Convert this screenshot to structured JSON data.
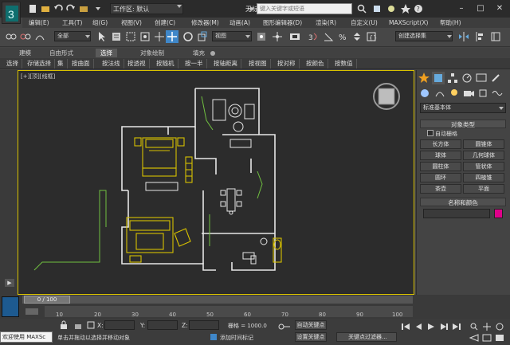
{
  "title_bar": {
    "workspace_label": "工作区: 默认",
    "document_title": "无标题",
    "search_placeholder": "键入关键字或短语"
  },
  "menu": {
    "items": [
      "编辑(E)",
      "工具(T)",
      "组(G)",
      "视图(V)",
      "创建(C)",
      "修改器(M)",
      "动画(A)",
      "图形编辑器(D)",
      "渲染(R)",
      "自定义(U)",
      "MAXScript(X)",
      "帮助(H)"
    ]
  },
  "toolbar": {
    "filter_value": "全部",
    "refcoord_value": "视图",
    "named_selection_placeholder": "创建选择集"
  },
  "ribbon": {
    "tabs": [
      "建模",
      "自由形式",
      "选择",
      "对象绘制",
      "填充"
    ],
    "active_tab": "选择"
  },
  "selection_bar": {
    "items": [
      "选择",
      "存储选择",
      "集",
      "按曲面",
      "按法线",
      "按透视",
      "按随机",
      "按一半",
      "按轴距离",
      "按视图",
      "按对称",
      "按颜色",
      "按数值"
    ]
  },
  "viewport": {
    "label": "[+][顶][线框]"
  },
  "command_panel": {
    "category": "标准基本体",
    "object_type_title": "对象类型",
    "autogrid_label": "自动栅格",
    "object_buttons": [
      "长方体",
      "圆锥体",
      "球体",
      "几何球体",
      "圆柱体",
      "管状体",
      "圆环",
      "四棱锥",
      "茶壶",
      "平面"
    ],
    "name_color_title": "名称和颜色",
    "object_color": "#e0008a"
  },
  "timeline": {
    "frame_display": "0 / 100",
    "tick_labels": [
      "10",
      "20",
      "30",
      "40",
      "50",
      "60",
      "70",
      "80",
      "90",
      "100"
    ]
  },
  "status": {
    "maxscript_label": "欢迎使用 MAXSc",
    "prompt": "单击并拖动以选择并移动对象",
    "add_time_tag": "添加时间标记",
    "x_label": "X:",
    "y_label": "Y:",
    "z_label": "Z:",
    "grid_label": "栅格 = 1000.0",
    "auto_key": "自动关键点",
    "set_key": "设置关键点",
    "key_filters": "关键点过滤器..."
  },
  "colors": {
    "selection_yellow": "#d8c100",
    "wire_white": "#e6e6e6",
    "wire_green": "#70c040",
    "accent_blue": "#1d5a90"
  }
}
